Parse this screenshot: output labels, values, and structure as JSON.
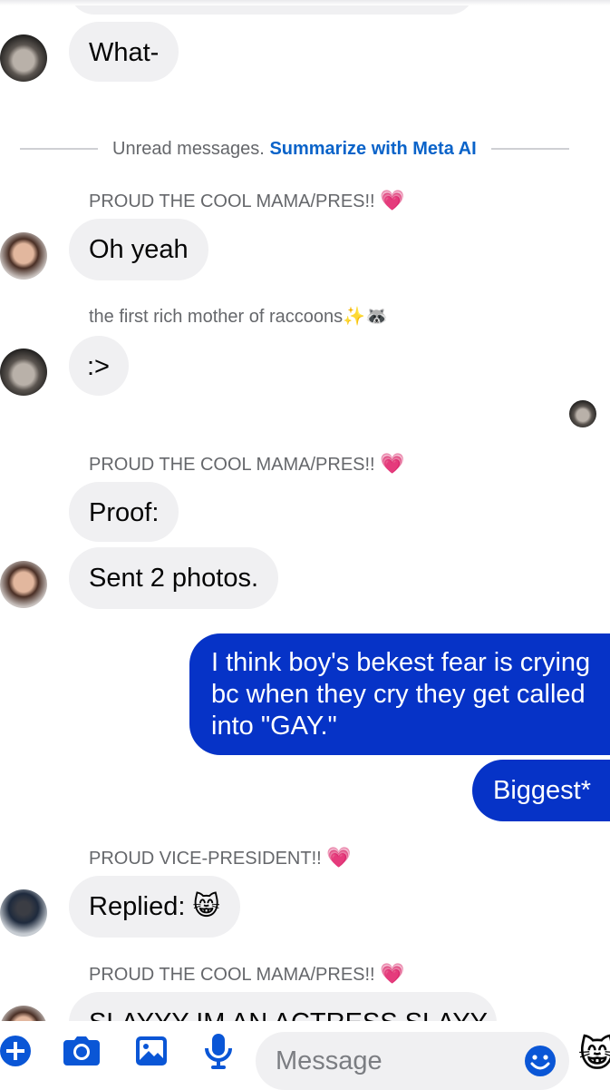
{
  "divider": {
    "text": "Unread messages.",
    "link": "Summarize with Meta AI"
  },
  "messages": [
    {
      "text": "What-"
    },
    {
      "sender": "PROUD THE COOL MAMA/PRES!!",
      "text": "Oh yeah"
    },
    {
      "sender": "the first rich mother of raccoons",
      "text": ":>"
    },
    {
      "sender": "PROUD THE COOL MAMA/PRES!!",
      "text": "Proof:",
      "text2": "Sent 2 photos."
    },
    {
      "line1": "I think boy's bekest fear is crying",
      "line2": "bc when they cry they get called",
      "line3": "into \"GAY.\""
    },
    {
      "text": "Biggest*"
    },
    {
      "sender": "PROUD VICE-PRESIDENT!!",
      "text": "Replied:"
    },
    {
      "sender": "PROUD THE COOL MAMA/PRES!!",
      "text": "SLAYYY IM AN ACTRESS SLAYY"
    }
  ],
  "composer": {
    "placeholder": "Message"
  },
  "colors": {
    "sent_bubble": "#0633c7",
    "received_bubble": "#f0f0f2",
    "accent": "#0a63c9"
  },
  "icons": [
    "plus-icon",
    "camera-icon",
    "image-icon",
    "microphone-icon",
    "emoji-icon",
    "cat-face-icon"
  ]
}
